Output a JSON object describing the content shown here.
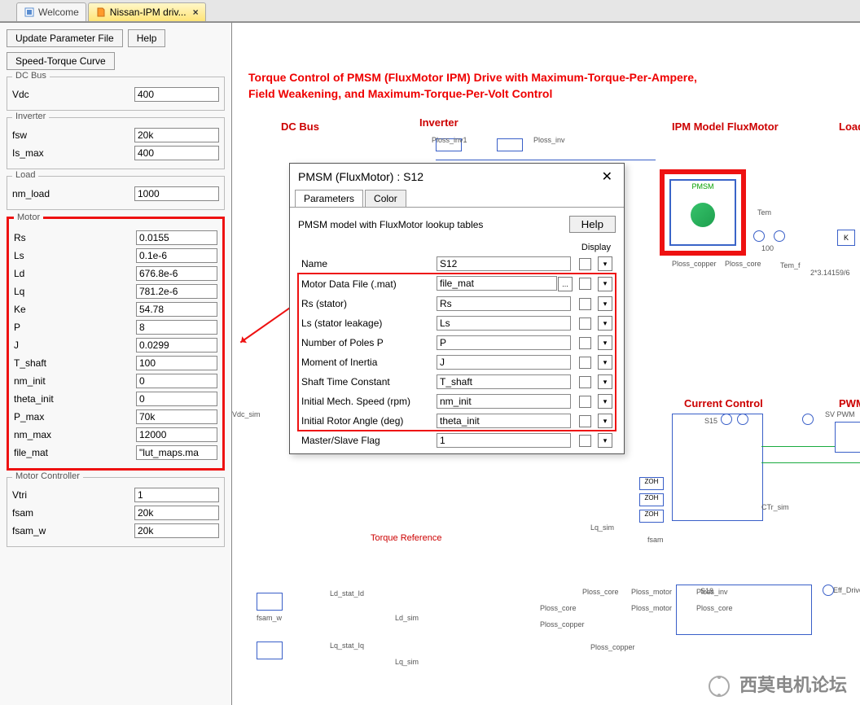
{
  "tabs": {
    "welcome": "Welcome",
    "file": "Nissan-IPM driv...",
    "close": "×"
  },
  "toolbar": {
    "update": "Update Parameter File",
    "help": "Help",
    "speed_torque": "Speed-Torque Curve"
  },
  "sidebar": {
    "dcbus": {
      "legend": "DC Bus",
      "Vdc_lab": "Vdc",
      "Vdc": "400"
    },
    "inverter": {
      "legend": "Inverter",
      "fsw_lab": "fsw",
      "fsw": "20k",
      "Is_max_lab": "Is_max",
      "Is_max": "400"
    },
    "load": {
      "legend": "Load",
      "nm_load_lab": "nm_load",
      "nm_load": "1000"
    },
    "motor": {
      "legend": "Motor",
      "Rs_lab": "Rs",
      "Rs": "0.0155",
      "Ls_lab": "Ls",
      "Ls": "0.1e-6",
      "Ld_lab": "Ld",
      "Ld": "676.8e-6",
      "Lq_lab": "Lq",
      "Lq": "781.2e-6",
      "Ke_lab": "Ke",
      "Ke": "54.78",
      "P_lab": "P",
      "P": "8",
      "J_lab": "J",
      "J": "0.0299",
      "T_shaft_lab": "T_shaft",
      "T_shaft": "100",
      "nm_init_lab": "nm_init",
      "nm_init": "0",
      "theta_init_lab": "theta_init",
      "theta_init": "0",
      "P_max_lab": "P_max",
      "P_max": "70k",
      "nm_max_lab": "nm_max",
      "nm_max": "12000",
      "file_mat_lab": "file_mat",
      "file_mat": "\"lut_maps.ma"
    },
    "controller": {
      "legend": "Motor Controller",
      "Vtri_lab": "Vtri",
      "Vtri": "1",
      "fsam_lab": "fsam",
      "fsam": "20k",
      "fsam_w_lab": "fsam_w",
      "fsam_w": "20k"
    }
  },
  "canvas": {
    "title1": "Torque Control of PMSM (FluxMotor IPM) Drive with Maximum-Torque-Per-Ampere,",
    "title2": "Field Weakening, and Maximum-Torque-Per-Volt Control",
    "labels": {
      "dcbus": "DC Bus",
      "inverter": "Inverter",
      "ipm": "IPM Model FluxMotor",
      "load": "Load",
      "cc": "Current Control",
      "pwm": "PWM",
      "torque": "Torque Reference",
      "pmsm": "PMSM"
    },
    "small": {
      "ploss_inv1": "Ploss_inv1",
      "ploss_inv": "Ploss_inv",
      "ploss_copper": "Ploss_copper",
      "ploss_core": "Ploss_core",
      "ploss_motor": "Ploss_motor",
      "tem": "Tem",
      "tem_f": "Tem_f",
      "vdc_sim": "Vdc_sim",
      "fsam": "fsam",
      "ctr_sim": "CTr_sim",
      "lq_sim": "Lq_sim",
      "ld_sim": "Ld_sim",
      "fsam_w": "fsam_w",
      "ld_stat": "Ld_stat_Id",
      "lq_stat": "Lq_stat_Iq",
      "eff_drive": "Eff_Drive",
      "svpwm": "SV PWM",
      "s15": "S15",
      "s18": "S18",
      "k": "K",
      "const": "2*3.14159/6",
      "hundred": "100"
    }
  },
  "dialog": {
    "title": "PMSM (FluxMotor) : S12",
    "tab_param": "Parameters",
    "tab_color": "Color",
    "desc": "PMSM model with FluxMotor lookup tables",
    "help": "Help",
    "display": "Display",
    "rows": {
      "name_l": "Name",
      "name_v": "S12",
      "file_l": "Motor Data File (.mat)",
      "file_v": "file_mat",
      "rs_l": "Rs (stator)",
      "rs_v": "Rs",
      "ls_l": "Ls (stator leakage)",
      "ls_v": "Ls",
      "p_l": "Number of Poles P",
      "p_v": "P",
      "j_l": "Moment of Inertia",
      "j_v": "J",
      "sh_l": "Shaft Time Constant",
      "sh_v": "T_shaft",
      "spd_l": "Initial Mech. Speed (rpm)",
      "spd_v": "nm_init",
      "ang_l": "Initial Rotor Angle (deg)",
      "ang_v": "theta_init",
      "ms_l": "Master/Slave Flag",
      "ms_v": "1"
    },
    "ellipsis": "..."
  },
  "watermark": "西莫电机论坛"
}
